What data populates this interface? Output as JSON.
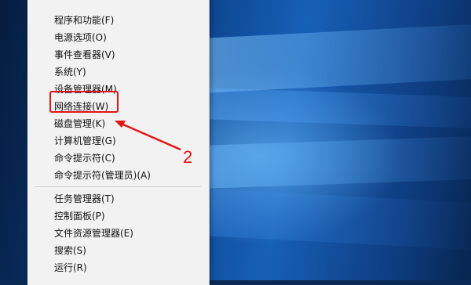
{
  "menu": {
    "items": [
      {
        "label": "程序和功能(F)"
      },
      {
        "label": "电源选项(O)"
      },
      {
        "label": "事件查看器(V)"
      },
      {
        "label": "系统(Y)"
      },
      {
        "label": "设备管理器(M)"
      },
      {
        "label": "网络连接(W)"
      },
      {
        "label": "磁盘管理(K)"
      },
      {
        "label": "计算机管理(G)"
      },
      {
        "label": "命令提示符(C)"
      },
      {
        "label": "命令提示符(管理员)(A)"
      },
      {
        "label": "任务管理器(T)"
      },
      {
        "label": "控制面板(P)"
      },
      {
        "label": "文件资源管理器(E)"
      },
      {
        "label": "搜索(S)"
      },
      {
        "label": "运行(R)"
      }
    ]
  },
  "annotation": {
    "step_number": "2",
    "highlight_color": "#e31414"
  }
}
